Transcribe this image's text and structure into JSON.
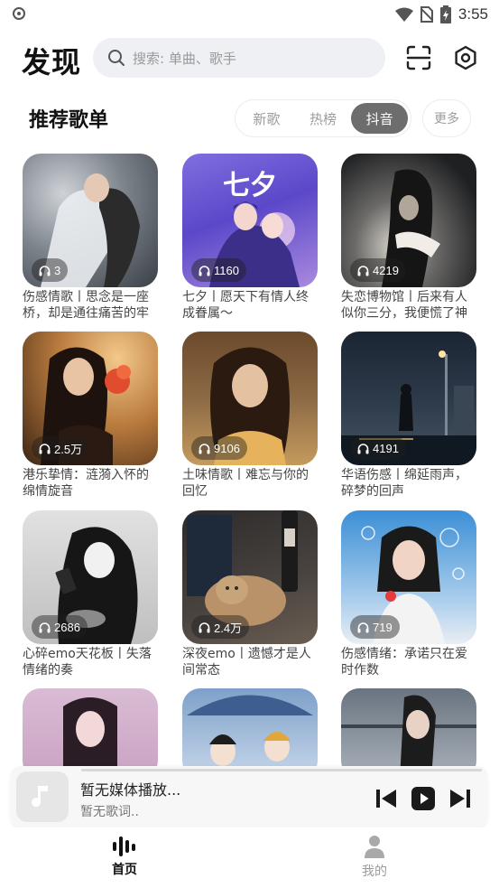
{
  "status": {
    "time": "3:55"
  },
  "header": {
    "app_title": "发现",
    "search_placeholder": "搜索: 单曲、歌手"
  },
  "section": {
    "title": "推荐歌单",
    "tabs": [
      {
        "label": "新歌",
        "active": false
      },
      {
        "label": "热榜",
        "active": false
      },
      {
        "label": "抖音",
        "active": true
      }
    ],
    "more_label": "更多"
  },
  "playlists": [
    {
      "count": "3",
      "title": "伤感情歌丨思念是一座桥，却是通往痛苦的牢"
    },
    {
      "count": "1160",
      "title": "七夕丨愿天下有情人终成眷属～"
    },
    {
      "count": "4219",
      "title": "失恋博物馆丨后来有人似你三分，我便慌了神"
    },
    {
      "count": "2.5万",
      "title": "港乐挚情：涟漪入怀的绵情旋音"
    },
    {
      "count": "9106",
      "title": "土味情歌丨难忘与你的回忆"
    },
    {
      "count": "4191",
      "title": "华语伤感丨绵延雨声，碎梦的回声"
    },
    {
      "count": "2686",
      "title": "心碎emo天花板丨失落情绪的奏"
    },
    {
      "count": "2.4万",
      "title": "深夜emo丨遗憾才是人间常态"
    },
    {
      "count": "719",
      "title": "伤感情绪：承诺只在爱时作数"
    }
  ],
  "cover_art_text": {
    "qixi": "七夕"
  },
  "player": {
    "title": "暂无媒体播放...",
    "subtitle": "暂无歌词.."
  },
  "nav": {
    "items": [
      {
        "label": "首页",
        "active": true
      },
      {
        "label": "我的",
        "active": false
      }
    ]
  },
  "colors": {
    "active_tab_bg": "#6d6d6d",
    "search_bg": "#eef0f3",
    "nav_active": "#111111",
    "nav_inactive": "#9a9a9a"
  }
}
